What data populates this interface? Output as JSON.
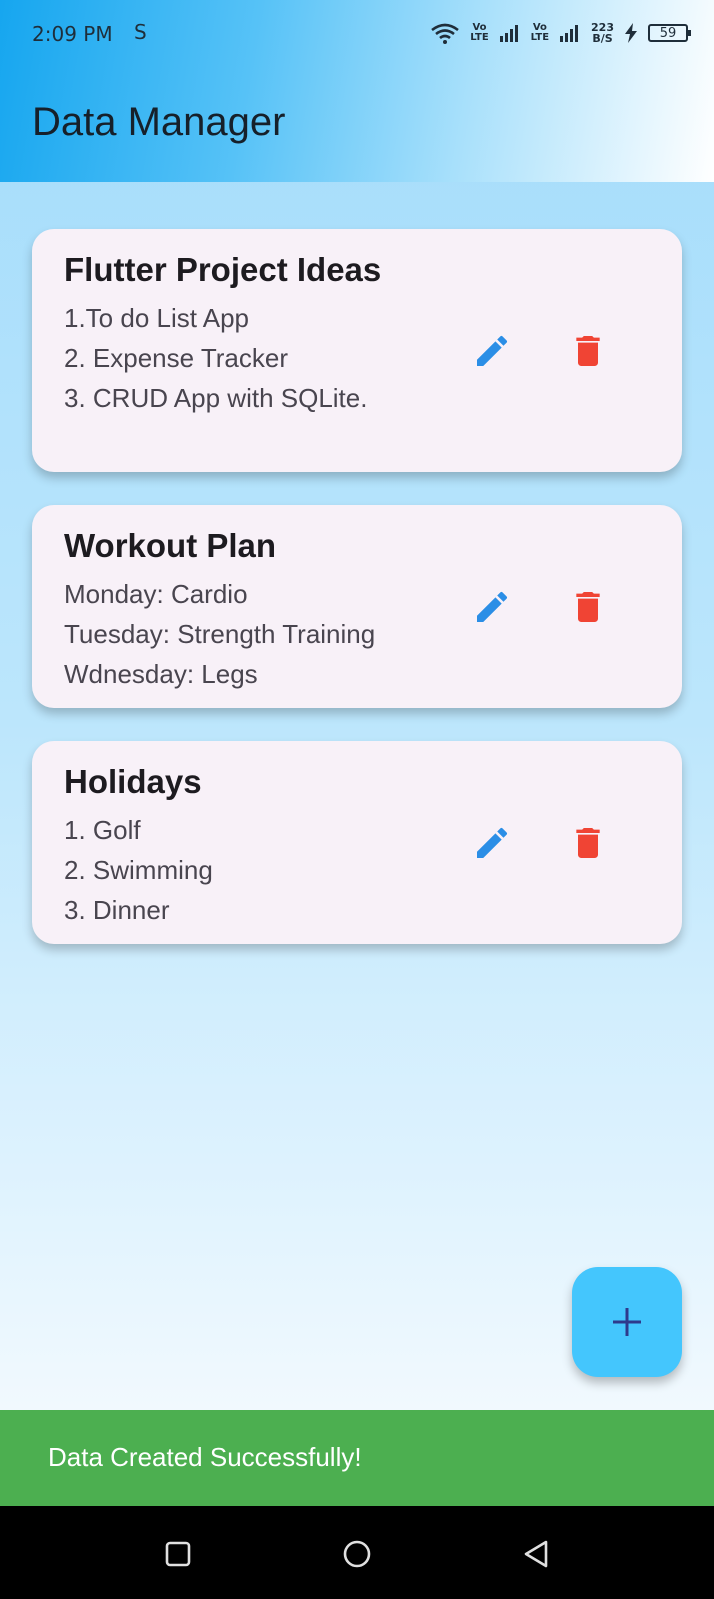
{
  "status_bar": {
    "time": "2:09 PM",
    "app_indicator": "S",
    "volte1": [
      "Vo",
      "LTE"
    ],
    "volte2": [
      "Vo",
      "LTE"
    ],
    "speed": [
      "223",
      "B/S"
    ],
    "battery": "59"
  },
  "app_bar": {
    "title": "Data Manager"
  },
  "cards": [
    {
      "title": "Flutter Project Ideas",
      "lines": [
        "1.To do List App",
        "2. Expense Tracker",
        "3. CRUD App with SQLite."
      ]
    },
    {
      "title": "Workout Plan",
      "lines": [
        "Monday: Cardio",
        "Tuesday: Strength Training",
        "Wdnesday: Legs"
      ]
    },
    {
      "title": "Holidays",
      "lines": [
        "1. Golf",
        "2. Swimming",
        "3. Dinner"
      ]
    }
  ],
  "icons": {
    "edit": "edit-icon",
    "delete": "delete-icon",
    "add": "add-icon"
  },
  "colors": {
    "edit": "#2b8ee6",
    "delete": "#f04434",
    "fab": "#44c6fd",
    "snackbar": "#4caf50"
  },
  "snackbar": {
    "message": "Data Created Successfully!"
  },
  "nav": {
    "items": [
      "recent-apps",
      "home",
      "back"
    ]
  }
}
